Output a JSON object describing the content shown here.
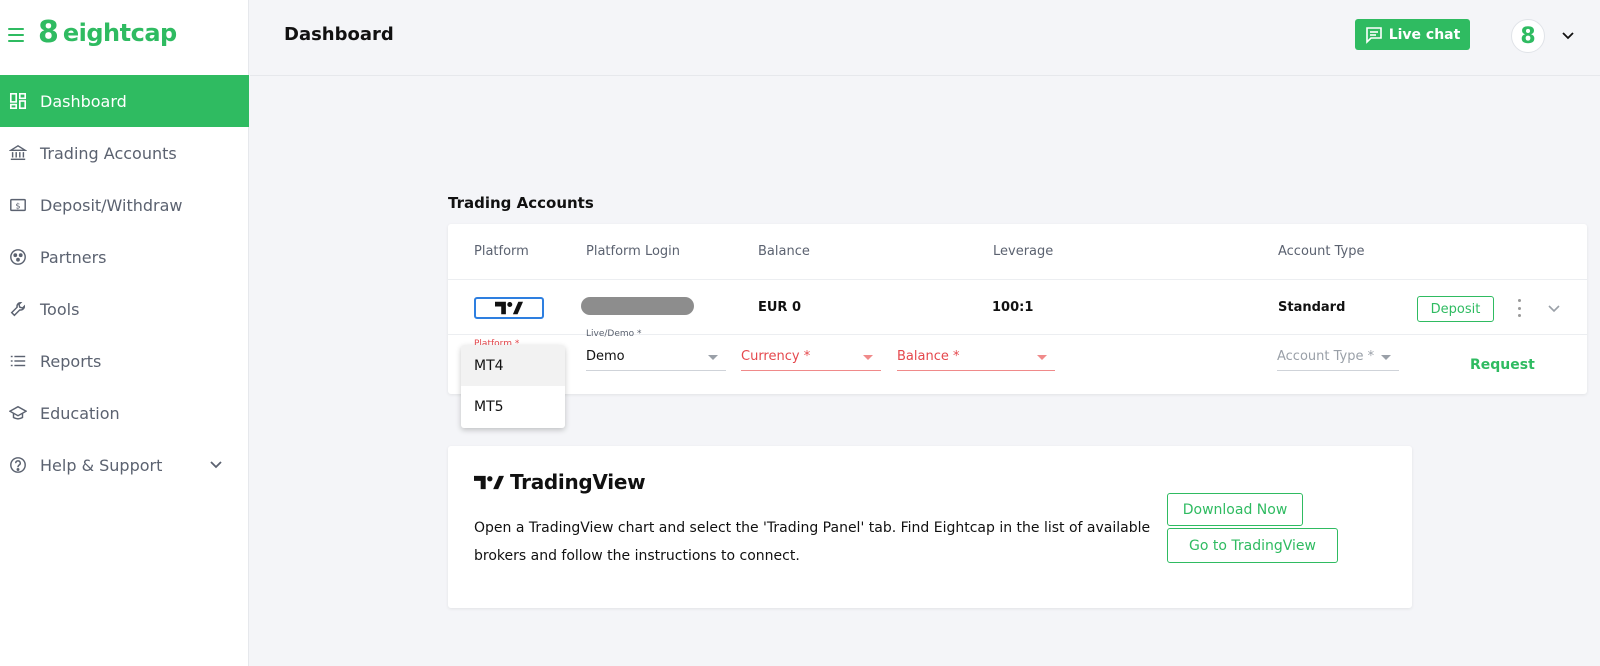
{
  "brand": {
    "name": "eightcap",
    "mark": "8"
  },
  "sidebar": {
    "items": [
      {
        "label": "Dashboard",
        "icon": "dashboard-icon",
        "active": true
      },
      {
        "label": "Trading Accounts",
        "icon": "bank-icon"
      },
      {
        "label": "Deposit/Withdraw",
        "icon": "dollar-note-icon"
      },
      {
        "label": "Partners",
        "icon": "partners-icon"
      },
      {
        "label": "Tools",
        "icon": "wrench-icon"
      },
      {
        "label": "Reports",
        "icon": "list-icon"
      },
      {
        "label": "Education",
        "icon": "graduation-cap-icon"
      },
      {
        "label": "Help & Support",
        "icon": "help-circle-icon",
        "expandable": true
      }
    ]
  },
  "header": {
    "title": "Dashboard",
    "live_chat": "Live chat",
    "avatar_initial": "8"
  },
  "accounts": {
    "title": "Trading Accounts",
    "columns": [
      "Platform",
      "Platform Login",
      "Balance",
      "Leverage",
      "Account Type"
    ],
    "row": {
      "platform": "TradingView",
      "balance": "EUR 0",
      "leverage": "100:1",
      "account_type": "Standard",
      "deposit": "Deposit"
    },
    "form": {
      "platform_label": "Platform *",
      "live_demo_label": "Live/Demo *",
      "live_demo_value": "Demo",
      "currency_placeholder": "Currency *",
      "balance_placeholder": "Balance *",
      "account_type_placeholder": "Account Type *",
      "request": "Request"
    },
    "platform_options": [
      "MT4",
      "MT5"
    ]
  },
  "tradingview": {
    "logo_text": "TradingView",
    "description": "Open a TradingView chart and select the 'Trading Panel' tab. Find Eightcap in the list of available brokers and follow the instructions to connect.",
    "download": "Download Now",
    "go_to": "Go to TradingView"
  },
  "colors": {
    "accent": "#2fbb61",
    "error": "#e5484d",
    "tv_blue": "#2e7fe0"
  }
}
